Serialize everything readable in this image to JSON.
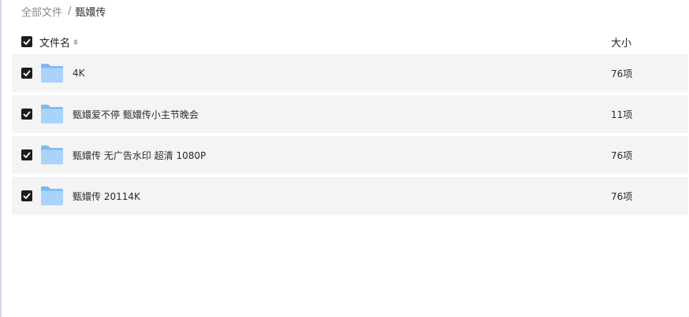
{
  "breadcrumb": {
    "root": "全部文件",
    "separator": "/",
    "current": "甄嬛传"
  },
  "header": {
    "name_label": "文件名",
    "size_label": "大小",
    "all_checked": true
  },
  "files": [
    {
      "name": "4K",
      "size": "76项",
      "checked": true,
      "icon": "folder-icon"
    },
    {
      "name": "甄嬛爱不停 甄嬛传小主节晚会",
      "size": "11项",
      "checked": true,
      "icon": "folder-icon"
    },
    {
      "name": "甄嬛传 无广告水印 超清 1080P",
      "size": "76项",
      "checked": true,
      "icon": "folder-icon"
    },
    {
      "name": "甄嬛传 20114K",
      "size": "76项",
      "checked": true,
      "icon": "folder-icon"
    }
  ],
  "colors": {
    "row_bg": "#f4f4f4",
    "checkbox": "#1c1c22",
    "folder_back": "#7fb8f2",
    "folder_front": "#a9d3fb"
  }
}
